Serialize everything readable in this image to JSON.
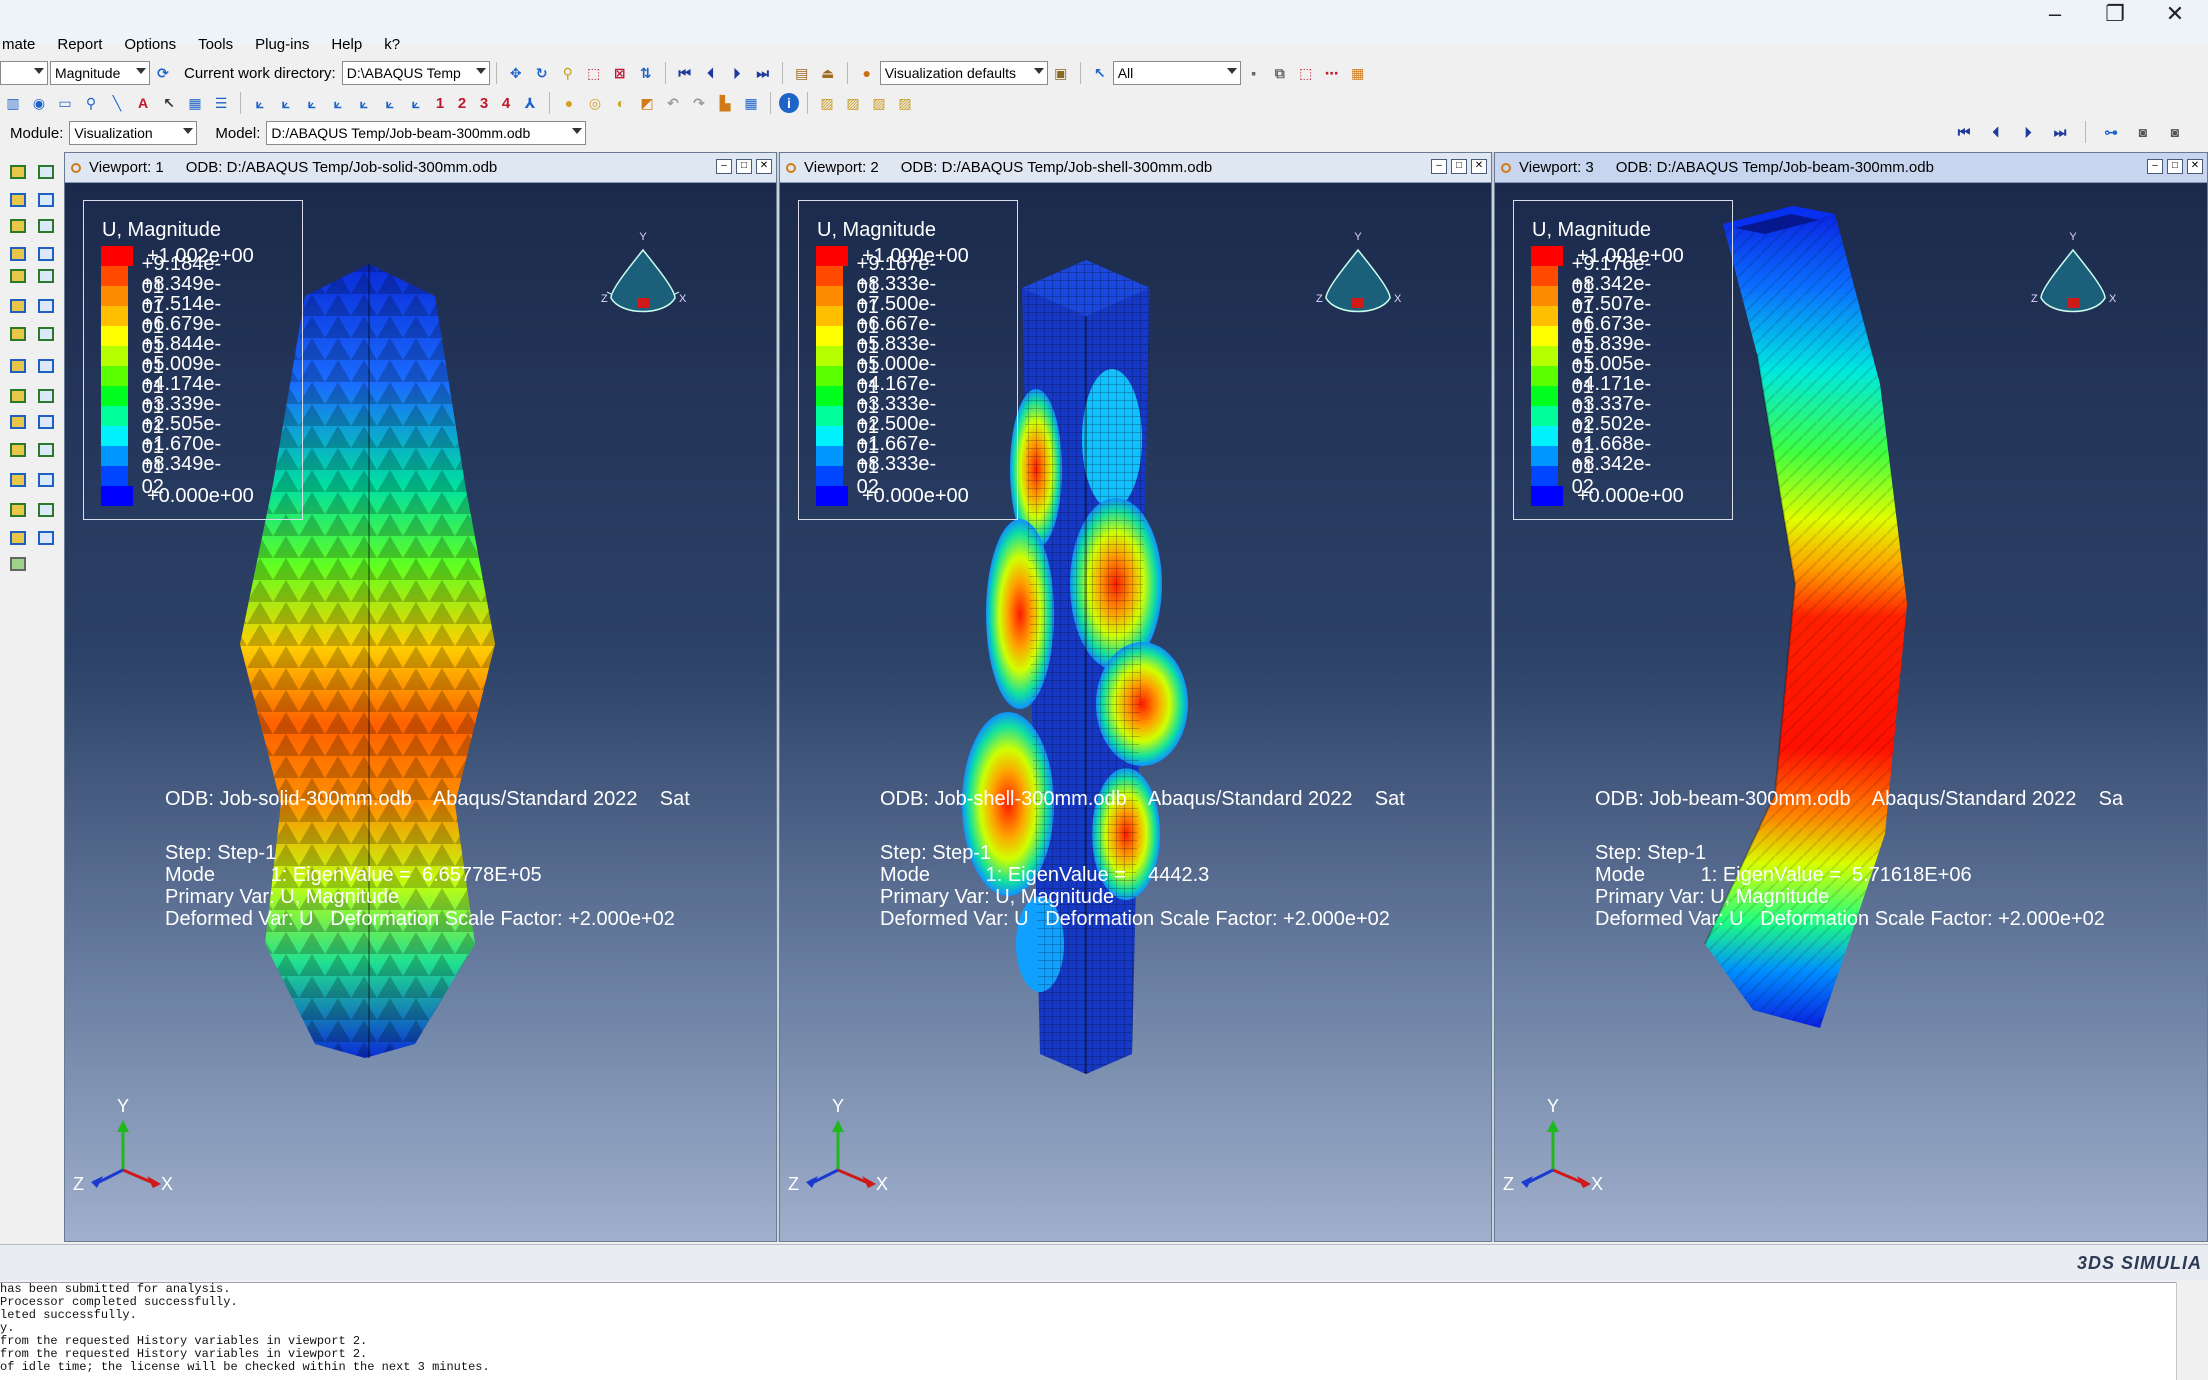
{
  "menu": {
    "items": [
      "mate",
      "Report",
      "Options",
      "Tools",
      "Plug-ins",
      "Help",
      "k?"
    ]
  },
  "window_controls": [
    "–",
    "❐",
    "✕"
  ],
  "toolbar1": {
    "result_field": "Magnitude",
    "cwd_label": "Current work directory:",
    "cwd_value": "D:\\ABAQUS Temp",
    "vis_defaults": "Visualization defaults",
    "selection_filter": "All"
  },
  "toolbar2": {
    "numbers": [
      "1",
      "2",
      "3",
      "4"
    ]
  },
  "context": {
    "module_label": "Module:",
    "module_value": "Visualization",
    "model_label": "Model:",
    "model_value": "D:/ABAQUS Temp/Job-beam-300mm.odb"
  },
  "colors": {
    "legend": [
      "#ff0000",
      "#ff4a00",
      "#ff8c00",
      "#ffbf00",
      "#ffff00",
      "#b6ff00",
      "#5aff00",
      "#00ff1e",
      "#00ff9a",
      "#00f2ff",
      "#0096ff",
      "#0046ff",
      "#0000ff"
    ]
  },
  "viewports": [
    {
      "title": "Viewport: 1",
      "odb": "ODB: D:/ABAQUS Temp/Job-solid-300mm.odb",
      "legend_title": "U, Magnitude",
      "legend_values": [
        "+1.002e+00",
        "+9.184e-01",
        "+8.349e-01",
        "+7.514e-01",
        "+6.679e-01",
        "+5.844e-01",
        "+5.009e-01",
        "+4.174e-01",
        "+3.339e-01",
        "+2.505e-01",
        "+1.670e-01",
        "+8.349e-02",
        "+0.000e+00"
      ],
      "odb_line": "ODB: Job-solid-300mm.odb    Abaqus/Standard 2022    Sat",
      "step": "Step: Step-1",
      "mode": "Mode          1: EigenValue =  6.65778E+05",
      "primary": "Primary Var: U, Magnitude",
      "deformed": "Deformed Var: U   Deformation Scale Factor: +2.000e+02"
    },
    {
      "title": "Viewport: 2",
      "odb": "ODB: D:/ABAQUS Temp/Job-shell-300mm.odb",
      "legend_title": "U, Magnitude",
      "legend_values": [
        "+1.000e+00",
        "+9.167e-01",
        "+8.333e-01",
        "+7.500e-01",
        "+6.667e-01",
        "+5.833e-01",
        "+5.000e-01",
        "+4.167e-01",
        "+3.333e-01",
        "+2.500e-01",
        "+1.667e-01",
        "+8.333e-02",
        "+0.000e+00"
      ],
      "odb_line": "ODB: Job-shell-300mm.odb    Abaqus/Standard 2022    Sat",
      "step": "Step: Step-1",
      "mode": "Mode          1: EigenValue =    4442.3",
      "primary": "Primary Var: U, Magnitude",
      "deformed": "Deformed Var: U   Deformation Scale Factor: +2.000e+02"
    },
    {
      "title": "Viewport: 3",
      "odb": "ODB: D:/ABAQUS Temp/Job-beam-300mm.odb",
      "legend_title": "U, Magnitude",
      "legend_values": [
        "+1.001e+00",
        "+9.176e-01",
        "+8.342e-01",
        "+7.507e-01",
        "+6.673e-01",
        "+5.839e-01",
        "+5.005e-01",
        "+4.171e-01",
        "+3.337e-01",
        "+2.502e-01",
        "+1.668e-01",
        "+8.342e-02",
        "+0.000e+00"
      ],
      "odb_line": "ODB: Job-beam-300mm.odb    Abaqus/Standard 2022    Sa",
      "step": "Step: Step-1",
      "mode": "Mode          1: EigenValue =  5.71618E+06",
      "primary": "Primary Var: U, Magnitude",
      "deformed": "Deformed Var: U   Deformation Scale Factor: +2.000e+02"
    }
  ],
  "axis_labels": {
    "x": "X",
    "y": "Y",
    "z": "Z"
  },
  "brand": "3DS SIMULIA",
  "console": [
    "has been submitted for analysis.",
    "Processor completed successfully.",
    "leted successfully.",
    "y.",
    "from the requested History variables in viewport 2.",
    "from the requested History variables in viewport 2.",
    "of idle time; the license will be checked within the next 3 minutes."
  ]
}
